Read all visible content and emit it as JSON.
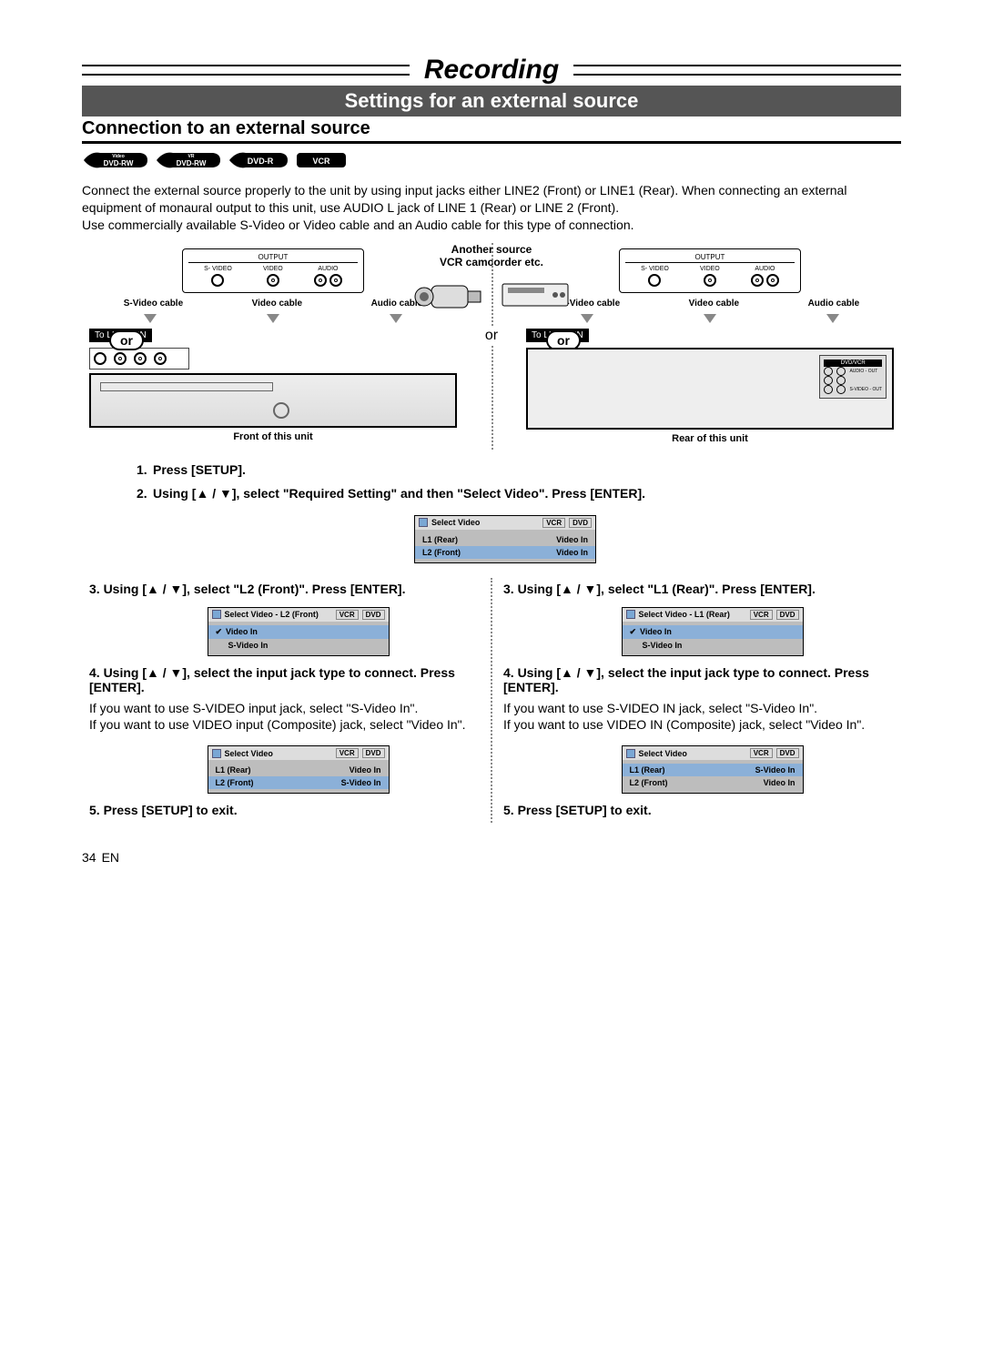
{
  "title": "Recording",
  "sectionBar": "Settings for an external source",
  "subheading": "Connection to an external source",
  "badges": [
    "DVD-RW",
    "DVD-RW",
    "DVD-R",
    "VCR"
  ],
  "badgeSubs": [
    "Video",
    "VR",
    "",
    ""
  ],
  "bodyText": "Connect the external source properly to the unit by using input jacks either LINE2 (Front) or LINE1 (Rear). When connecting an external equipment of monaural output to this unit, use AUDIO L jack of LINE 1 (Rear) or LINE 2 (Front).\nUse commercially available S-Video or Video cable and an Audio cable for this type of connection.",
  "diagram": {
    "outputLabel": "OUTPUT",
    "jackLabels": [
      "S- VIDEO",
      "VIDEO",
      "AUDIO"
    ],
    "or": "or",
    "cableLabels": [
      "S-Video cable",
      "Video cable",
      "Audio cable"
    ],
    "sourceLabel": "Another source\nVCR camcorder etc.",
    "line2": "To LINE 2 IN",
    "line1": "To LINE 1 IN",
    "frontCaption": "Front of this unit",
    "rearCaption": "Rear of this unit",
    "centerOr": "or",
    "rearIO": {
      "dvdvcr": "DVD/VCR",
      "audioOut": "AUDIO - OUT",
      "svOut": "S-VIDEO - OUT"
    }
  },
  "stepsTop": [
    {
      "n": "1.",
      "text": "Press [SETUP]."
    },
    {
      "n": "2.",
      "text": "Using [▲ / ▼], select \"Required Setting\" and then \"Select Video\". Press [ENTER]."
    }
  ],
  "osdTop": {
    "title": "Select Video",
    "vcr": "VCR",
    "dvd": "DVD",
    "rows": [
      {
        "l": "L1 (Rear)",
        "r": "Video In",
        "sel": false
      },
      {
        "l": "L2 (Front)",
        "r": "Video In",
        "sel": true
      }
    ]
  },
  "left": {
    "step3": "3. Using [▲ / ▼], select \"L2 (Front)\". Press [ENTER].",
    "osd3": {
      "title": "Select Video - L2 (Front)",
      "vcr": "VCR",
      "dvd": "DVD",
      "rows": [
        {
          "l": "Video In",
          "check": true,
          "sel": true
        },
        {
          "l": "S-Video In",
          "check": false,
          "sel": false
        }
      ]
    },
    "step4": "4. Using [▲ / ▼], select the input jack type to connect. Press [ENTER].",
    "step4body": "If you want to use S-VIDEO input jack, select \"S-Video In\".\nIf you want to use VIDEO input (Composite) jack, select \"Video In\".",
    "osd4": {
      "title": "Select Video",
      "vcr": "VCR",
      "dvd": "DVD",
      "rows": [
        {
          "l": "L1 (Rear)",
          "r": "Video In",
          "sel": false
        },
        {
          "l": "L2 (Front)",
          "r": "S-Video In",
          "sel": true
        }
      ]
    },
    "step5": "5. Press [SETUP] to exit."
  },
  "right": {
    "step3": "3. Using [▲ / ▼], select \"L1 (Rear)\". Press [ENTER].",
    "osd3": {
      "title": "Select Video - L1 (Rear)",
      "vcr": "VCR",
      "dvd": "DVD",
      "rows": [
        {
          "l": "Video In",
          "check": true,
          "sel": true
        },
        {
          "l": "S-Video In",
          "check": false,
          "sel": false
        }
      ]
    },
    "step4": "4. Using [▲ / ▼], select the input jack type to connect. Press [ENTER].",
    "step4body": "If you want to use S-VIDEO IN jack, select \"S-Video In\".\nIf you want to use VIDEO IN (Composite) jack, select \"Video In\".",
    "osd4": {
      "title": "Select Video",
      "vcr": "VCR",
      "dvd": "DVD",
      "rows": [
        {
          "l": "L1 (Rear)",
          "r": "S-Video In",
          "sel": true
        },
        {
          "l": "L2 (Front)",
          "r": "Video In",
          "sel": false
        }
      ]
    },
    "step5": "5. Press [SETUP] to exit."
  },
  "pageNumber": "34",
  "pageLang": "EN"
}
